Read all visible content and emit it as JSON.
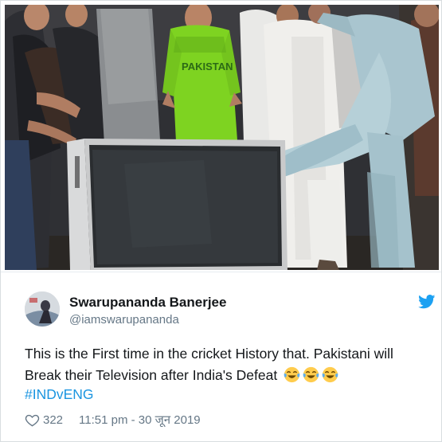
{
  "tweet": {
    "author_name": "Swarupananda Banerjee",
    "author_handle": "@iamswarupananda",
    "text": "This is the First time in the cricket History that.  Pakistani will Break their Television after India's Defeat",
    "emojis": [
      "😂",
      "😂",
      "😂"
    ],
    "hashtag": "#INDvENG",
    "likes": "322",
    "timestamp": "11:51 pm - 30 जून 2019"
  },
  "photo": {
    "jersey_text": "PAKISTAN"
  },
  "icons": {
    "brand": "twitter-bird-icon",
    "like": "heart-icon",
    "reaction": "tears-of-joy-emoji"
  },
  "colors": {
    "twitter_blue": "#1da1f2",
    "link": "#1b95e0",
    "secondary_text": "#657786",
    "jersey_green": "#7ed321"
  }
}
